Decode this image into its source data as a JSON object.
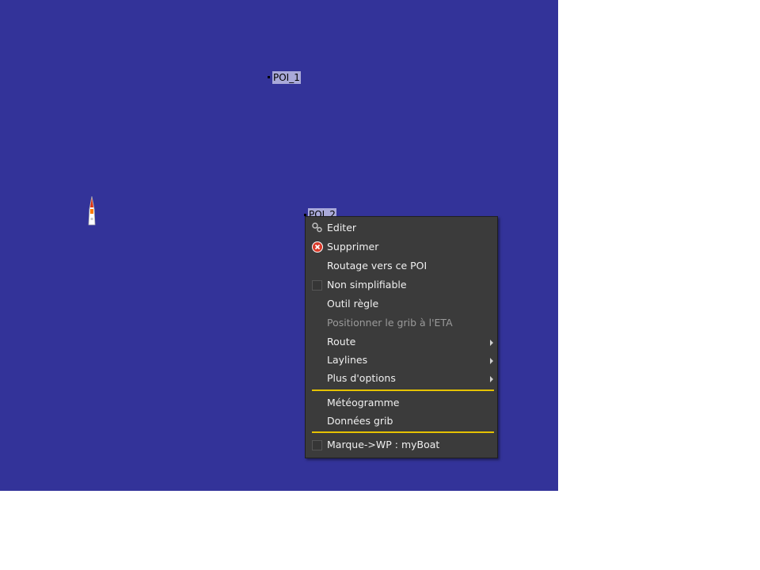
{
  "map": {
    "background_color": "#333399",
    "pois": [
      {
        "name": "POI_1"
      },
      {
        "name": "POI_2"
      }
    ]
  },
  "context_menu": {
    "items": [
      {
        "label": "Editer",
        "icon": "edit-icon"
      },
      {
        "label": "Supprimer",
        "icon": "delete-icon"
      },
      {
        "label": "Routage vers ce POI"
      },
      {
        "label": "Non simplifiable",
        "checkbox": true,
        "checked": false
      },
      {
        "label": "Outil règle"
      },
      {
        "label": "Positionner le grib à l'ETA",
        "disabled": true
      },
      {
        "label": "Route",
        "submenu": true
      },
      {
        "label": "Laylines",
        "submenu": true
      },
      {
        "label": "Plus d'options",
        "submenu": true
      },
      {
        "label": "Météogramme"
      },
      {
        "label": "Données grib"
      },
      {
        "label": "Marque->WP :  myBoat",
        "checkbox": true,
        "checked": false
      }
    ],
    "separator_color": "#e5c200"
  }
}
